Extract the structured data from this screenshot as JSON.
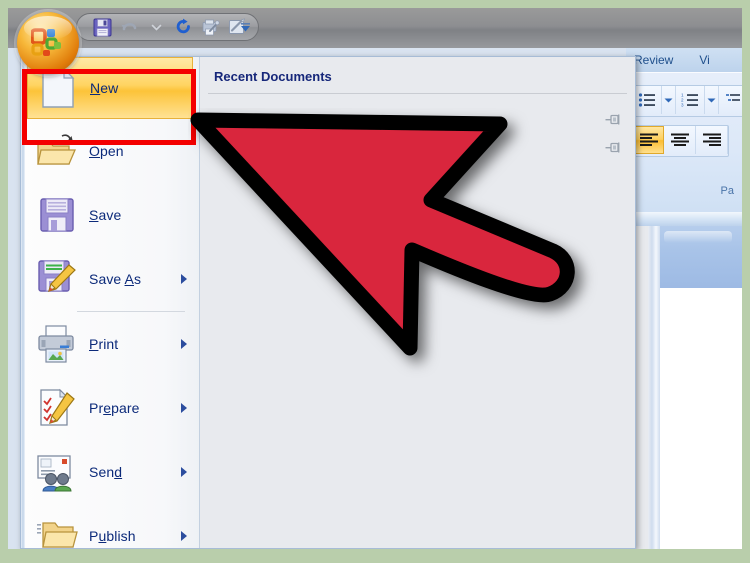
{
  "window": {
    "title_bar_icon": "office-orb-icon"
  },
  "quick_access_toolbar": {
    "buttons": [
      {
        "name": "save-icon",
        "label": "Save"
      },
      {
        "name": "undo-icon",
        "label": "Undo"
      },
      {
        "name": "undo-dropdown-icon",
        "label": "Undo History"
      },
      {
        "name": "redo-icon",
        "label": "Redo"
      },
      {
        "name": "quick-print-icon",
        "label": "Quick Print"
      },
      {
        "name": "quick-edit-icon",
        "label": "Edit"
      }
    ],
    "customize_label": "Customize Quick Access Toolbar"
  },
  "office_menu": {
    "items": [
      {
        "label": "New",
        "accel_index": 0,
        "icon": "new-document-icon",
        "submenu": false,
        "highlighted": true,
        "separator_after": false
      },
      {
        "label": "Open",
        "accel_index": 0,
        "icon": "open-folder-icon",
        "submenu": false,
        "highlighted": false,
        "separator_after": false
      },
      {
        "label": "Save",
        "accel_index": 0,
        "icon": "floppy-disk-icon",
        "submenu": false,
        "highlighted": false,
        "separator_after": false
      },
      {
        "label": "Save As",
        "accel_index": 5,
        "icon": "save-as-icon",
        "submenu": true,
        "highlighted": false,
        "separator_after": true
      },
      {
        "label": "Print",
        "accel_index": 0,
        "icon": "printer-icon",
        "submenu": true,
        "highlighted": false,
        "separator_after": false
      },
      {
        "label": "Prepare",
        "accel_index": 3,
        "icon": "prepare-icon",
        "submenu": true,
        "highlighted": false,
        "separator_after": false
      },
      {
        "label": "Send",
        "accel_index": 3,
        "icon": "send-icon",
        "submenu": true,
        "highlighted": false,
        "separator_after": false
      },
      {
        "label": "Publish",
        "accel_index": 1,
        "icon": "publish-folder-icon",
        "submenu": true,
        "highlighted": false,
        "separator_after": false
      }
    ],
    "right_panel": {
      "heading": "Recent Documents",
      "documents": [],
      "pins": [
        "pin-icon",
        "pin-icon"
      ]
    }
  },
  "annotation": {
    "highlight_target": "New",
    "highlight_color": "#f40000",
    "cursor_color": "#d9253c",
    "cursor_outline": "#000000"
  },
  "ribbon": {
    "tabs": [
      {
        "label": "Review",
        "active": false
      },
      {
        "label": "Vi",
        "active": false
      }
    ],
    "groups": [
      {
        "name": "Paragraph",
        "display_label": "Pa",
        "controls": [
          {
            "name": "bullet-list-icon",
            "label": "Bullets",
            "has_dropdown": true,
            "active": false
          },
          {
            "name": "numbered-list-icon",
            "label": "Numbering",
            "has_dropdown": true,
            "active": false
          },
          {
            "name": "multilevel-list-icon",
            "label": "Multilevel List",
            "has_dropdown": true,
            "active": false
          },
          {
            "name": "align-left-icon",
            "label": "Align Text Left",
            "has_dropdown": false,
            "active": true
          },
          {
            "name": "align-center-icon",
            "label": "Center",
            "has_dropdown": false,
            "active": false
          },
          {
            "name": "align-right-icon",
            "label": "Align Text Right",
            "has_dropdown": false,
            "active": false
          }
        ]
      }
    ]
  },
  "colors": {
    "matte_green": "#b9ceab",
    "titlebar_gray": "#8d8e91",
    "menu_highlight_gold": "#ffd462",
    "menu_text_blue": "#0c2a7a",
    "recent_heading_blue": "#16277a",
    "panel_gray": "#e8eaee",
    "ribbon_blue": "#cddef2"
  }
}
